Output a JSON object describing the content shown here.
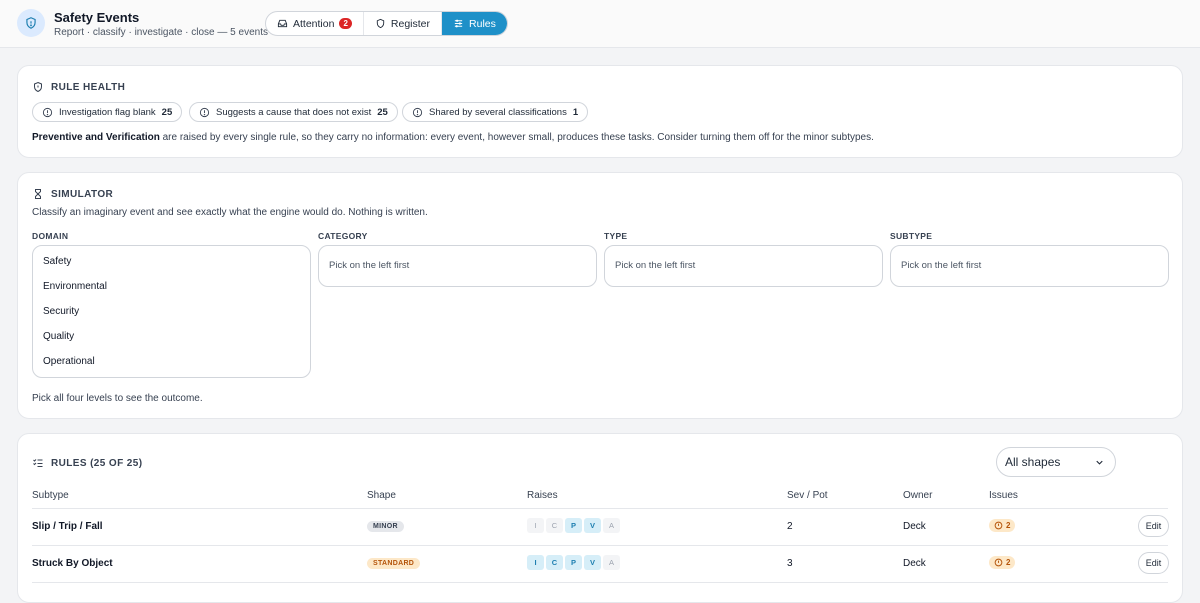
{
  "header": {
    "title": "Safety Events",
    "subtitle": "Report · classify · investigate · close — 5 events",
    "tabs": [
      {
        "label": "Attention",
        "badge": "2"
      },
      {
        "label": "Register"
      },
      {
        "label": "Rules",
        "active": true
      }
    ]
  },
  "rule_health": {
    "heading": "RULE HEALTH",
    "chips": [
      {
        "label": "Investigation flag blank",
        "count": "25"
      },
      {
        "label": "Suggests a cause that does not exist",
        "count": "25"
      },
      {
        "label": "Shared by several classifications",
        "count": "1"
      }
    ],
    "note_bold": "Preventive and Verification",
    "note_rest": " are raised by every single rule, so they carry no information: every event, however small, produces these tasks. Consider turning them off for the minor subtypes."
  },
  "simulator": {
    "heading": "SIMULATOR",
    "description": "Classify an imaginary event and see exactly what the engine would do. Nothing is written.",
    "levels": {
      "domain": "DOMAIN",
      "category": "CATEGORY",
      "type": "TYPE",
      "subtype": "SUBTYPE"
    },
    "domain_options": [
      "Safety",
      "Environmental",
      "Security",
      "Quality",
      "Operational"
    ],
    "placeholder": "Pick on the left first",
    "footer": "Pick all four levels to see the outcome."
  },
  "rules": {
    "heading": "RULES (25 OF 25)",
    "filter": "All shapes",
    "columns": {
      "subtype": "Subtype",
      "shape": "Shape",
      "raises": "Raises",
      "sev_pot": "Sev / Pot",
      "owner": "Owner",
      "issues": "Issues"
    },
    "edit_label": "Edit",
    "rows": [
      {
        "subtype": "Slip / Trip / Fall",
        "shape": "MINOR",
        "raises": [
          {
            "l": "I",
            "on": false
          },
          {
            "l": "C",
            "on": false
          },
          {
            "l": "P",
            "on": true
          },
          {
            "l": "V",
            "on": true
          },
          {
            "l": "A",
            "on": false
          }
        ],
        "sev": "2",
        "owner": "Deck",
        "issues": "2"
      },
      {
        "subtype": "Struck By Object",
        "shape": "STANDARD",
        "raises": [
          {
            "l": "I",
            "on": true
          },
          {
            "l": "C",
            "on": true
          },
          {
            "l": "P",
            "on": true
          },
          {
            "l": "V",
            "on": true
          },
          {
            "l": "A",
            "on": false
          }
        ],
        "sev": "3",
        "owner": "Deck",
        "issues": "2"
      }
    ]
  },
  "colors": {
    "accent": "#1e90c8",
    "warning": "#b45309",
    "danger": "#dc2626"
  }
}
